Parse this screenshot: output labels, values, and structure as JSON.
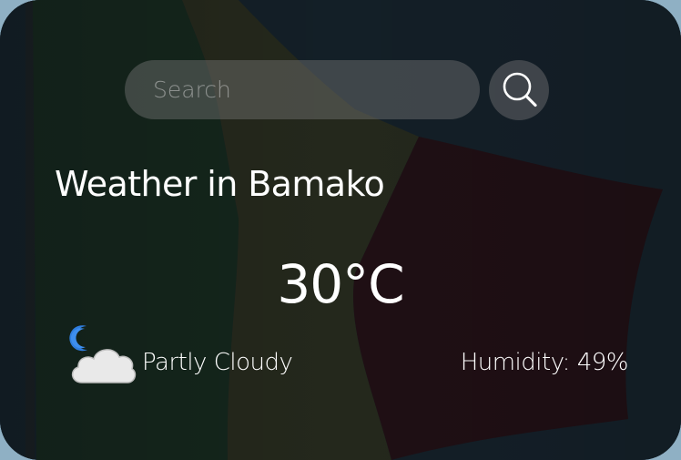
{
  "search": {
    "placeholder": "Search",
    "value": "",
    "button_icon": "search-icon"
  },
  "weather": {
    "title": "Weather in Bamako",
    "temperature": "30°C",
    "condition": "Partly Cloudy",
    "condition_icon": "partly-cloudy-night-icon",
    "humidity": "Humidity: 49%"
  },
  "background": {
    "image": "flag-of-mali",
    "flag_colors": [
      "#14b53a",
      "#fcd116",
      "#ce1126"
    ]
  }
}
